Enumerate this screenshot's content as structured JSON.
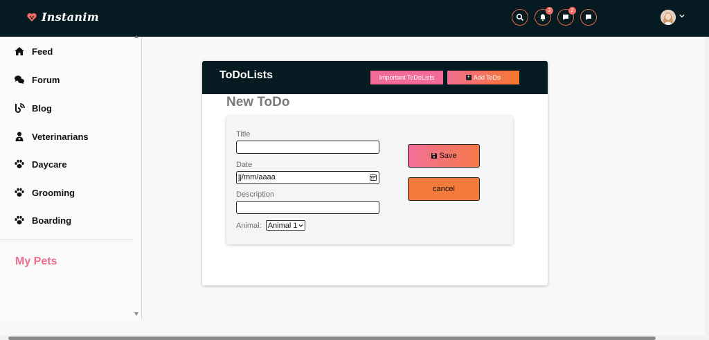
{
  "app": {
    "brand_name": "Instanim"
  },
  "topbar": {
    "icons": [
      "search-icon",
      "bell-icon",
      "chat-icon",
      "message-icon"
    ],
    "notifications_count": "3",
    "chat_count": "2",
    "accent_color": "#e8674a"
  },
  "sidebar": {
    "items": [
      {
        "label": "Feed",
        "icon": "home-icon"
      },
      {
        "label": "Forum",
        "icon": "comments-icon"
      },
      {
        "label": "Blog",
        "icon": "blog-icon"
      },
      {
        "label": "Veterinarians",
        "icon": "doctor-icon"
      },
      {
        "label": "Daycare",
        "icon": "paw-icon"
      },
      {
        "label": "Grooming",
        "icon": "paw-icon"
      },
      {
        "label": "Boarding",
        "icon": "paw-icon"
      }
    ],
    "my_pets": "My Pets"
  },
  "card": {
    "title": "ToDoLists",
    "important_label": "Important ToDoLists",
    "add_label": "Add ToDo",
    "form_heading": "New ToDo",
    "fields": {
      "title_label": "Title",
      "title_value": "",
      "date_label": "Date",
      "date_value": "jj/mm/aaaa",
      "description_label": "Description",
      "description_value": "",
      "animal_label": "Animal:",
      "animal_selected": "Animal 1"
    },
    "save_label": "Save",
    "cancel_label": "cancel"
  },
  "colors": {
    "navbar": "#061b21",
    "pink": "#f06b95",
    "orange": "#f47a3c",
    "my_pets": "#ec6f8e"
  }
}
